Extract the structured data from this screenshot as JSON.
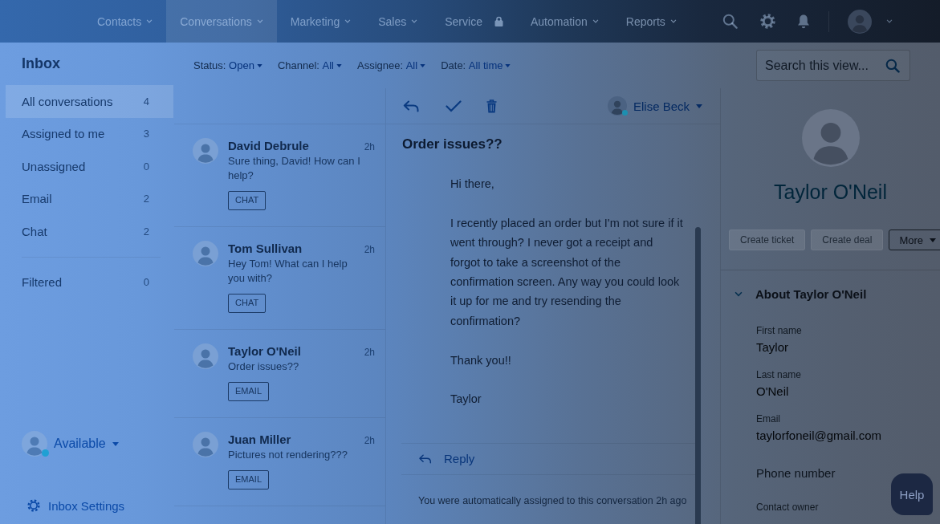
{
  "top_nav": {
    "items": [
      {
        "label": "Contacts",
        "kind": "dropdown",
        "selected": false
      },
      {
        "label": "Conversations",
        "kind": "dropdown",
        "selected": true
      },
      {
        "label": "Marketing",
        "kind": "dropdown",
        "selected": false
      },
      {
        "label": "Sales",
        "kind": "dropdown",
        "selected": false
      },
      {
        "label": "Service",
        "kind": "locked",
        "selected": false
      },
      {
        "label": "Automation",
        "kind": "dropdown",
        "selected": false
      },
      {
        "label": "Reports",
        "kind": "dropdown",
        "selected": false
      }
    ]
  },
  "sidebar": {
    "title": "Inbox",
    "views": [
      {
        "label": "All conversations",
        "count": "4",
        "selected": true
      },
      {
        "label": "Assigned to me",
        "count": "3",
        "selected": false
      },
      {
        "label": "Unassigned",
        "count": "0",
        "selected": false
      },
      {
        "label": "Email",
        "count": "2",
        "selected": false
      },
      {
        "label": "Chat",
        "count": "2",
        "selected": false
      }
    ],
    "filters": [
      {
        "label": "Filtered",
        "count": "0",
        "selected": false
      }
    ],
    "status": {
      "label": "Available",
      "online": true
    },
    "settings_link": "Inbox Settings"
  },
  "filter_bar": [
    {
      "label": "Status:",
      "value": "Open"
    },
    {
      "label": "Channel:",
      "value": "All"
    },
    {
      "label": "Assignee:",
      "value": "All"
    },
    {
      "label": "Date:",
      "value": "All time"
    }
  ],
  "search": {
    "placeholder": "Search this view..."
  },
  "conversations": [
    {
      "name": "David Debrule",
      "time": "2h",
      "preview": "Sure thing, David! How can I help?",
      "channel": "CHAT"
    },
    {
      "name": "Tom Sullivan",
      "time": "2h",
      "preview": "Hey Tom! What can I help you with?",
      "channel": "CHAT"
    },
    {
      "name": "Taylor O'Neil",
      "time": "2h",
      "preview": "Order issues??",
      "channel": "EMAIL"
    },
    {
      "name": "Juan Miller",
      "time": "2h",
      "preview": "Pictures not rendering???",
      "channel": "EMAIL"
    }
  ],
  "thread": {
    "assignee": {
      "name": "Elise Beck",
      "online": true
    },
    "subject": "Order issues??",
    "message": [
      "Hi there,",
      "I recently placed an order but I'm not sure if it went through? I never got a receipt and forgot to take a screenshot of the confirmation screen. Any way you could look it up for me and try resending the confirmation?",
      "Thank you!!",
      "Taylor"
    ],
    "reply_label": "Reply",
    "note": "You were automatically assigned to this conversation 2h ago"
  },
  "contact": {
    "name": "Taylor O'Neil",
    "actions": [
      {
        "label": "Create ticket",
        "kind": "button",
        "disabled": true
      },
      {
        "label": "Create deal",
        "kind": "button",
        "disabled": true
      },
      {
        "label": "More",
        "kind": "dropdown",
        "disabled": false
      }
    ],
    "section": {
      "title": "About Taylor O'Neil",
      "expanded": true,
      "fields": [
        {
          "label": "First name",
          "value": "Taylor",
          "kind": "value"
        },
        {
          "label": "Last name",
          "value": "O'Neil",
          "kind": "value"
        },
        {
          "label": "Email",
          "value": "taylorfoneil@gmail.com",
          "kind": "value"
        },
        {
          "label": "Phone number",
          "kind": "empty"
        },
        {
          "label": "Contact owner",
          "kind": "label"
        }
      ]
    }
  },
  "help_button": {
    "label": "Help"
  }
}
